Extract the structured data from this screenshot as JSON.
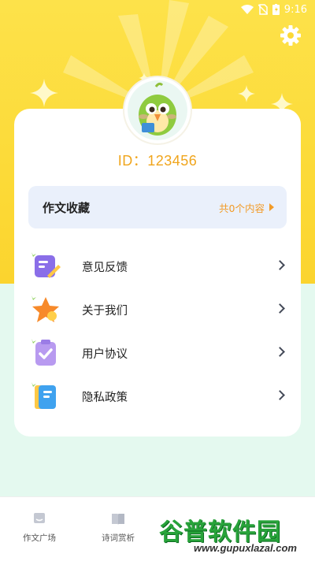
{
  "status_bar": {
    "time": "9:16"
  },
  "profile": {
    "id_label": "ID：123456"
  },
  "favorites": {
    "title": "作文收藏",
    "count_text": "共0个内容"
  },
  "menu": [
    {
      "label": "意见反馈",
      "icon": "feedback-icon"
    },
    {
      "label": "关于我们",
      "icon": "star-icon"
    },
    {
      "label": "用户协议",
      "icon": "clipboard-check-icon"
    },
    {
      "label": "隐私政策",
      "icon": "notebook-icon"
    }
  ],
  "tabs": [
    {
      "label": "作文广场",
      "icon": "chat-bubble-icon"
    },
    {
      "label": "诗词赏析",
      "icon": "book-icon"
    }
  ],
  "watermark": {
    "brand": "谷普软件园",
    "url": "www.gupuxlazal.com"
  },
  "colors": {
    "hero_yellow": "#fcd935",
    "accent_orange": "#f29b28",
    "id_orange": "#f0a51c",
    "mint_bg": "#e4f9ef"
  }
}
